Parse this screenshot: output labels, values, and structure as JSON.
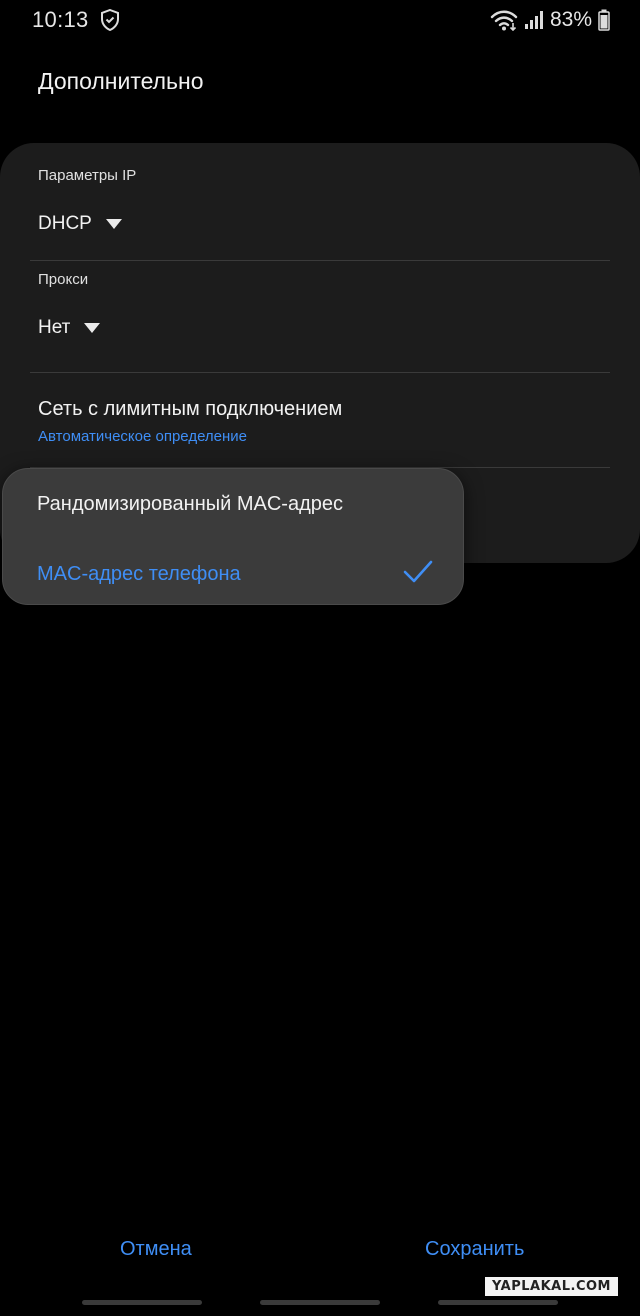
{
  "status_bar": {
    "time": "10:13",
    "battery": "83%",
    "icons": [
      "shield-icon",
      "wifi-icon",
      "signal-icon",
      "battery-icon"
    ]
  },
  "page": {
    "title": "Дополнительно"
  },
  "settings": {
    "ip_label": "Параметры IP",
    "ip_value": "DHCP",
    "proxy_label": "Прокси",
    "proxy_value": "Нет",
    "metered_title": "Сеть с лимитным подключением",
    "metered_value": "Автоматическое определение"
  },
  "mac_menu": {
    "options": [
      {
        "label": "Рандомизированный MAC-адрес",
        "selected": false
      },
      {
        "label": "MAC-адрес телефона",
        "selected": true
      }
    ]
  },
  "buttons": {
    "cancel": "Отмена",
    "save": "Сохранить"
  },
  "watermark": "YAPLAKAL.COM",
  "colors": {
    "background": "#000000",
    "card": "#1c1c1c",
    "popup": "#3b3b3b",
    "accent": "#3f8ef5",
    "text": "#f2f2f2"
  }
}
